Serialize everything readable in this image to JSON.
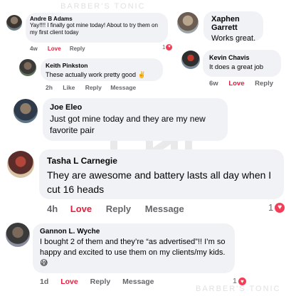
{
  "watermark": {
    "text": "BARBER'S TONIC"
  },
  "comments": [
    {
      "name": "Andre B Adams",
      "text": "Yay!!!! I finally got mine today! About to try them on my first client today",
      "time": "4w",
      "love": "Love",
      "reply": "Reply",
      "count": "1"
    },
    {
      "name": "Xaphen Garrett",
      "text": "Works great."
    },
    {
      "name": "Kevin Chavis",
      "text": "It does a great job",
      "time": "6w",
      "love": "Love",
      "reply": "Reply"
    },
    {
      "name": "Keith Pinkston",
      "text": "These actually work pretty good ✌️",
      "time": "2h",
      "like": "Like",
      "reply": "Reply",
      "message": "Message"
    },
    {
      "name": "Joe Eleo",
      "text": "Just got mine today and they are my new favorite pair"
    },
    {
      "name": "Tasha L Carnegie",
      "text": "They are awesome and battery lasts all day when I cut 16 heads",
      "time": "4h",
      "love": "Love",
      "reply": "Reply",
      "message": "Message",
      "count": "1"
    },
    {
      "name": "Gannon L. Wyche",
      "text": "I bought 2 of them and they’re “as advertised”!! I’m so happy and excited to use them on my clients/my kids. 😅",
      "time": "1d",
      "love": "Love",
      "reply": "Reply",
      "message": "Message",
      "count": "1"
    }
  ]
}
